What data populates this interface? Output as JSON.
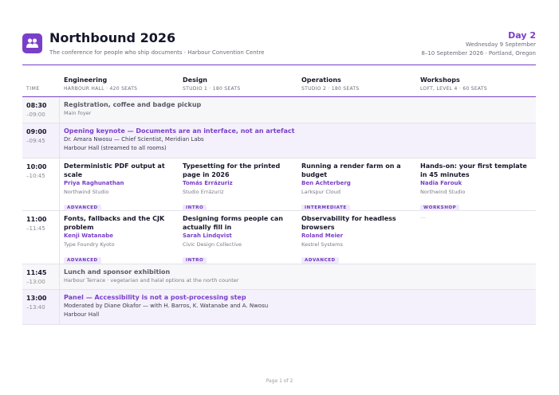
{
  "header": {
    "title": "Northbound 2026",
    "subtitle": "The conference for people who ship documents · Harbour Convention Centre",
    "day_label": "Day 2",
    "date": "Wednesday 9 September",
    "range": "8–10 September 2026 · Portland, Oregon",
    "logo_icon": "people-icon",
    "accent": "#7a3fc8"
  },
  "table": {
    "time_header": "TIME",
    "tracks": [
      {
        "name": "Engineering",
        "venue": "HARBOUR HALL · 420 SEATS"
      },
      {
        "name": "Design",
        "venue": "STUDIO 1 · 180 SEATS"
      },
      {
        "name": "Operations",
        "venue": "STUDIO 2 · 180 SEATS"
      },
      {
        "name": "Workshops",
        "venue": "LOFT, LEVEL 4 · 60 SEATS"
      }
    ]
  },
  "rows": {
    "r1": {
      "start": "08:30",
      "end": "–09:00",
      "title": "Registration, coffee and badge pickup",
      "desc": "Main foyer"
    },
    "r2": {
      "start": "09:00",
      "end": "–09:45",
      "title": "Opening keynote — Documents are an interface, not an artefact",
      "line1": "Dr. Amara Nwosu — Chief Scientist, Meridian Labs",
      "line2": "Harbour Hall (streamed to all rooms)"
    },
    "r3": {
      "start": "10:00",
      "end": "–10:45",
      "sessions": [
        {
          "title": "Deterministic PDF output at scale",
          "speaker": "Priya Raghunathan",
          "org": "Northwind Studio",
          "level": "ADVANCED"
        },
        {
          "title": "Typesetting for the printed page in 2026",
          "speaker": "Tomás Errázuriz",
          "org": "Studio Errázuriz",
          "level": "INTRO"
        },
        {
          "title": "Running a render farm on a budget",
          "speaker": "Ben Achterberg",
          "org": "Larkspur Cloud",
          "level": "INTERMEDIATE"
        },
        {
          "title": "Hands-on: your first template in 45 minutes",
          "speaker": "Nadia Farouk",
          "org": "Northwind Studio",
          "level": "WORKSHOP"
        }
      ]
    },
    "r4": {
      "start": "11:00",
      "end": "–11:45",
      "sessions": [
        {
          "title": "Fonts, fallbacks and the CJK problem",
          "speaker": "Kenji Watanabe",
          "org": "Type Foundry Kyoto",
          "level": "ADVANCED"
        },
        {
          "title": "Designing forms people can actually fill in",
          "speaker": "Sarah Lindqvist",
          "org": "Civic Design Collective",
          "level": "INTRO"
        },
        {
          "title": "Observability for headless browsers",
          "speaker": "Roland Meier",
          "org": "Kestrel Systems",
          "level": "ADVANCED"
        }
      ],
      "empty": "—"
    },
    "r5": {
      "start": "11:45",
      "end": "–13:00",
      "title": "Lunch and sponsor exhibition",
      "desc": "Harbour Terrace · vegetarian and halal options at the north counter"
    },
    "r6": {
      "start": "13:00",
      "end": "–13:40",
      "title": "Panel — Accessibility is not a post-processing step",
      "line1": "Moderated by Diane Okafor — with H. Barros, K. Watanabe and A. Nwosu",
      "line2": "Harbour Hall"
    }
  },
  "footer": {
    "page": "Page 1 of 2"
  }
}
